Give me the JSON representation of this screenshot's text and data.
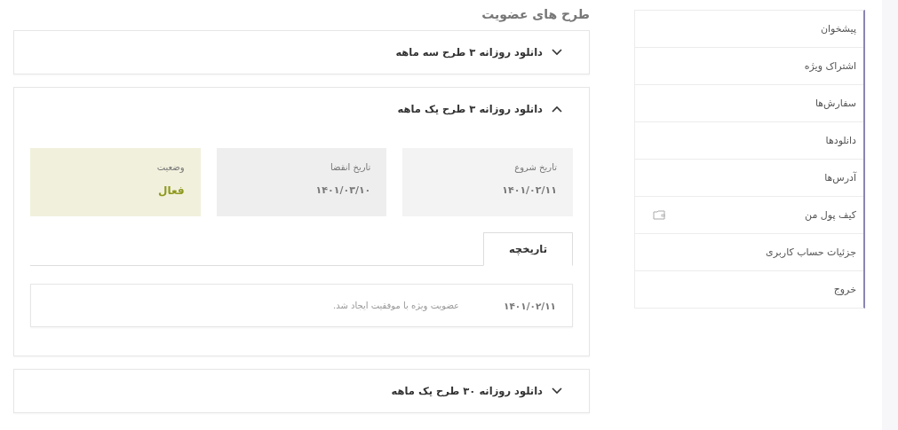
{
  "page_title": "طرح های عضویت",
  "plans": [
    {
      "title": "دانلود روزانه ۳ طرح سه ماهه",
      "expanded": false
    },
    {
      "title": "دانلود روزانه ۳ طرح یک ماهه",
      "expanded": true,
      "cards": [
        {
          "kind": "date",
          "label": "تاریخ شروع",
          "value": "۱۴۰۱/۰۲/۱۱",
          "color": "#f3f3f3"
        },
        {
          "kind": "date",
          "label": "تاریخ انقضا",
          "value": "۱۴۰۱/۰۳/۱۰",
          "color": "#eeeeee"
        },
        {
          "kind": "status",
          "label": "وضعیت",
          "value": "فعال",
          "color": "#f1f0dc"
        }
      ],
      "tabs": [
        {
          "label": "تاریخچه",
          "selected": true
        }
      ],
      "history": [
        {
          "date": "۱۴۰۱/۰۲/۱۱",
          "message": "عضویت ویژه با موفقیت ایجاد شد."
        }
      ]
    },
    {
      "title": "دانلود روزانه ۳۰ طرح یک ماهه",
      "expanded": false
    }
  ],
  "sidebar": {
    "items": [
      {
        "label": "پیشخوان",
        "kind": "link"
      },
      {
        "label": "اشتراک ویژه",
        "kind": "link"
      },
      {
        "label": "سفارش‌ها",
        "kind": "link"
      },
      {
        "label": "دانلودها",
        "kind": "link"
      },
      {
        "label": "آدرس‌ها",
        "kind": "link"
      },
      {
        "label": "کیف پول من",
        "kind": "wallet"
      },
      {
        "label": "جزئیات حساب کاربری",
        "kind": "link"
      },
      {
        "label": "خروج",
        "kind": "link"
      }
    ]
  }
}
